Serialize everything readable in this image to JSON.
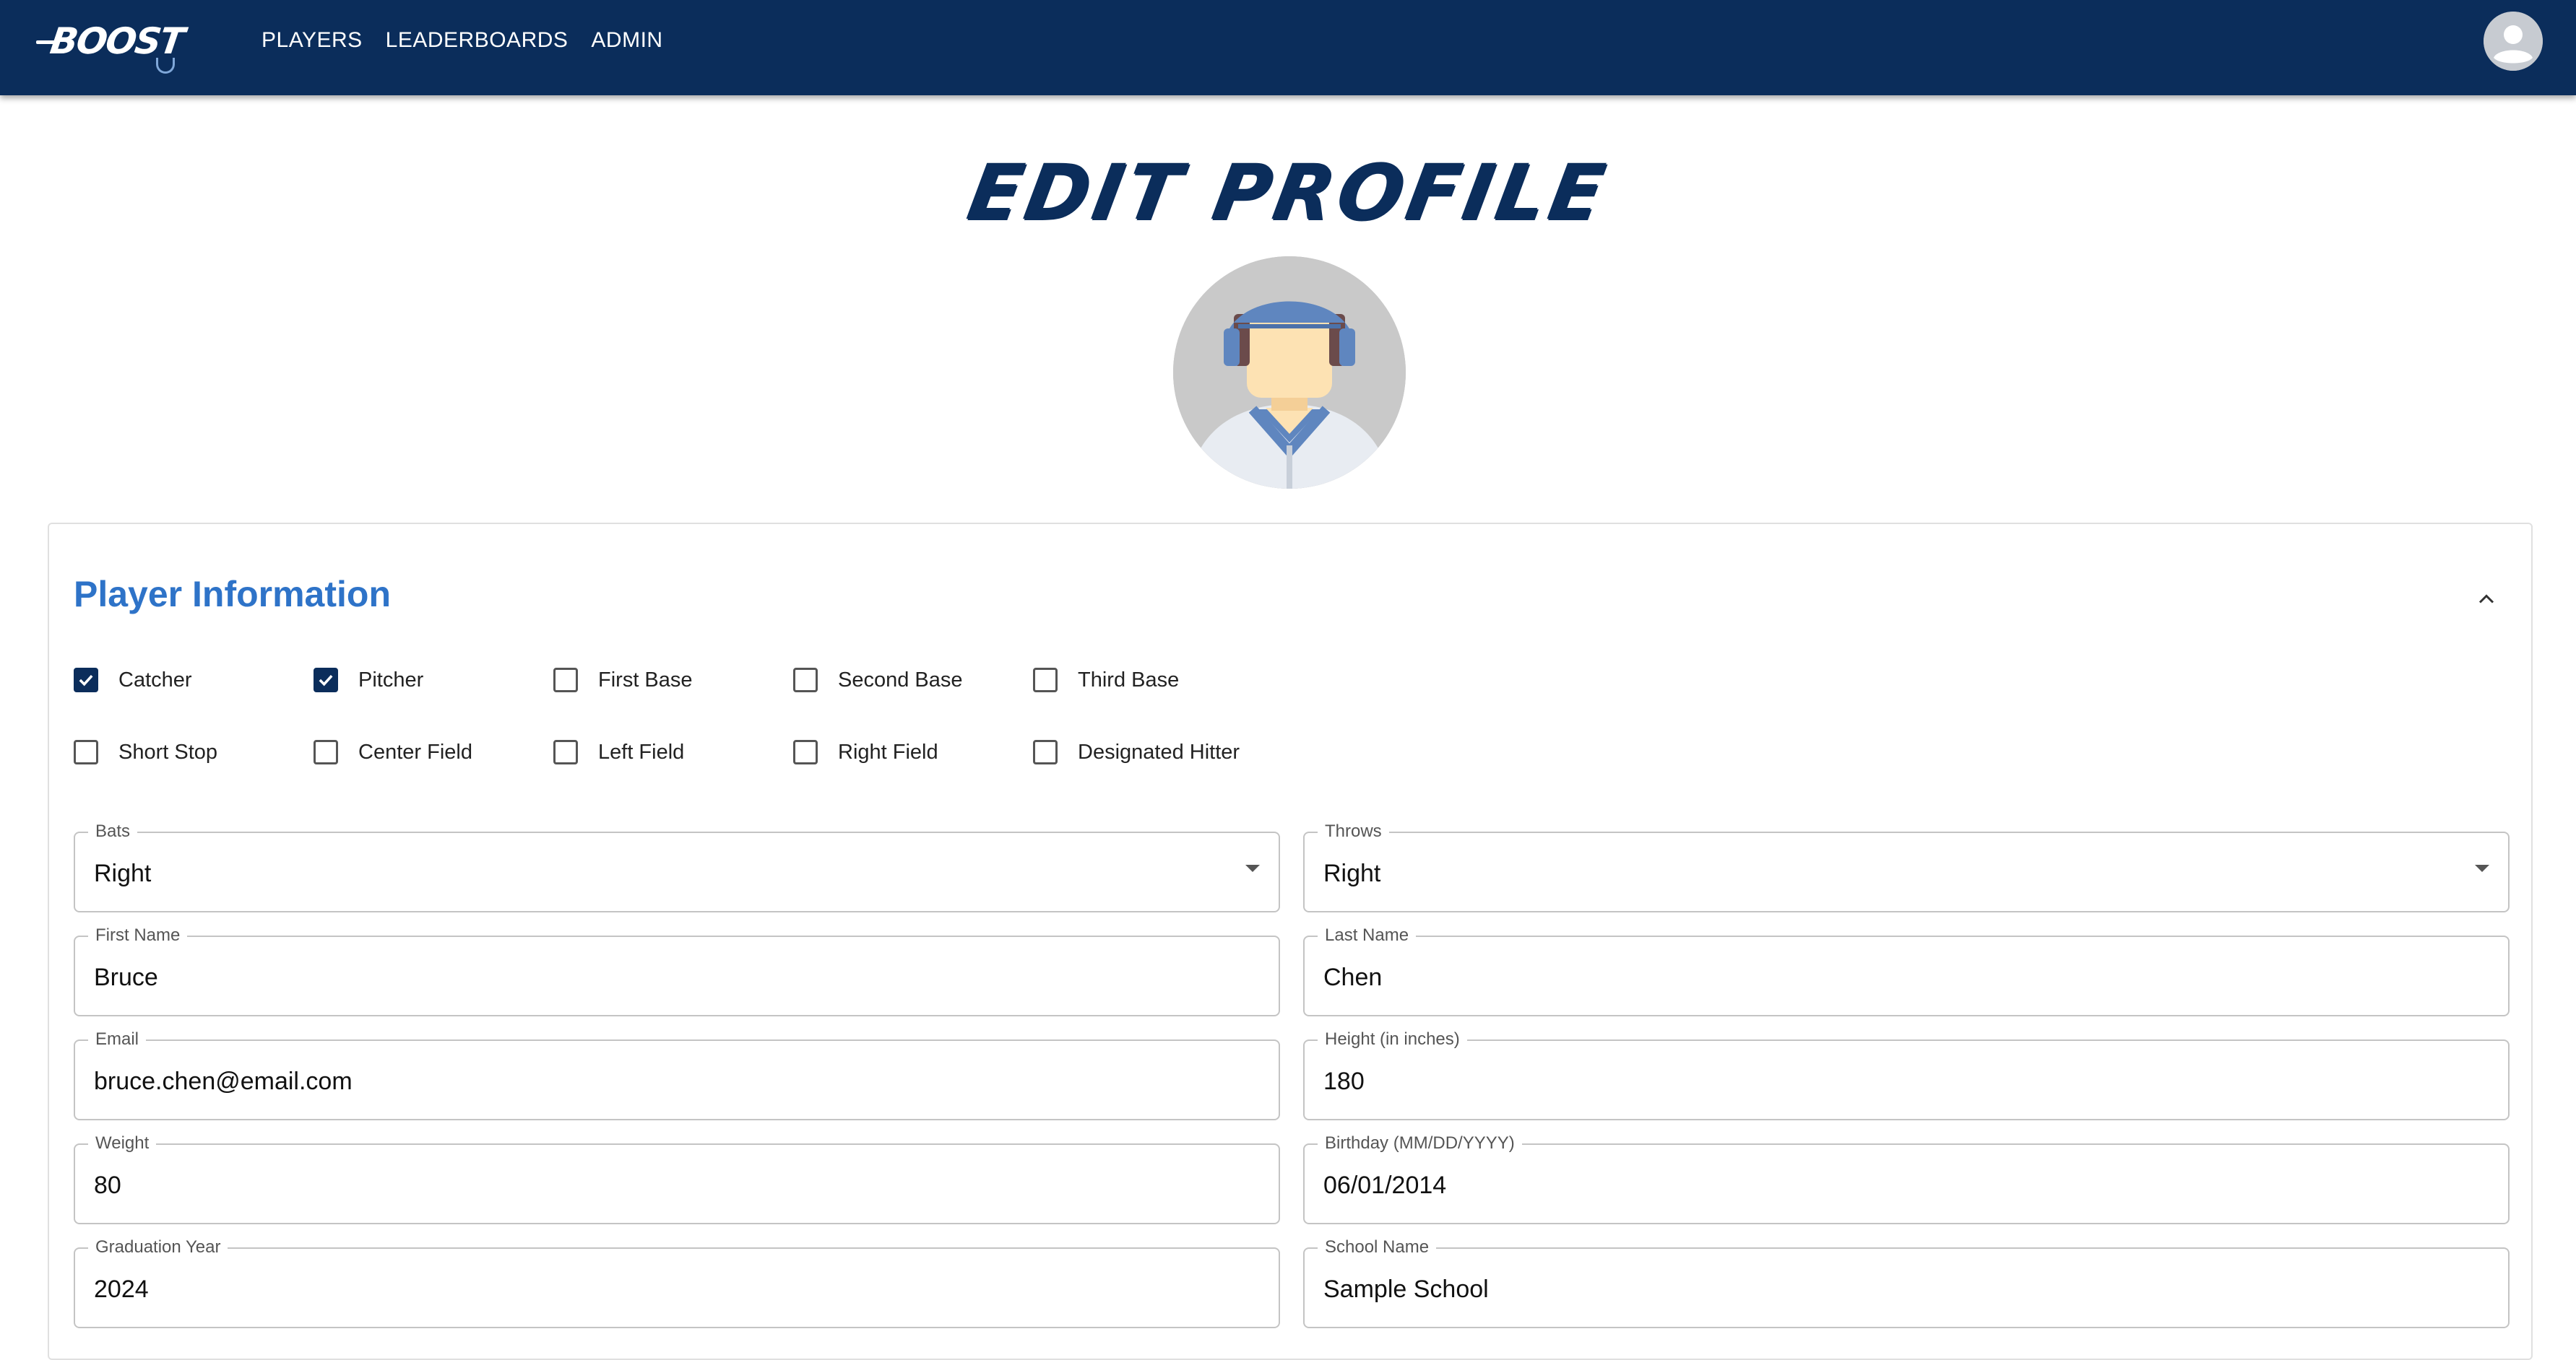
{
  "nav": {
    "logo_text": "BOOST",
    "links": [
      "PLAYERS",
      "LEADERBOARDS",
      "ADMIN"
    ]
  },
  "page": {
    "title": "EDIT PROFILE"
  },
  "card": {
    "title": "Player Information",
    "positions_row1": [
      {
        "label": "Catcher",
        "checked": true
      },
      {
        "label": "Pitcher",
        "checked": true
      },
      {
        "label": "First Base",
        "checked": false
      },
      {
        "label": "Second Base",
        "checked": false
      },
      {
        "label": "Third Base",
        "checked": false
      }
    ],
    "positions_row2": [
      {
        "label": "Short Stop",
        "checked": false
      },
      {
        "label": "Center Field",
        "checked": false
      },
      {
        "label": "Left Field",
        "checked": false
      },
      {
        "label": "Right Field",
        "checked": false
      },
      {
        "label": "Designated Hitter",
        "checked": false
      }
    ],
    "fields": {
      "bats": {
        "label": "Bats",
        "value": "Right"
      },
      "throws": {
        "label": "Throws",
        "value": "Right"
      },
      "first_name": {
        "label": "First Name",
        "value": "Bruce"
      },
      "last_name": {
        "label": "Last Name",
        "value": "Chen"
      },
      "email": {
        "label": "Email",
        "value": "bruce.chen@email.com"
      },
      "height": {
        "label": "Height (in inches)",
        "value": "180"
      },
      "weight": {
        "label": "Weight",
        "value": "80"
      },
      "birthday": {
        "label": "Birthday (MM/DD/YYYY)",
        "value": "06/01/2014"
      },
      "graduation_year": {
        "label": "Graduation Year",
        "value": "2024"
      },
      "school_name": {
        "label": "School Name",
        "value": "Sample School"
      }
    }
  },
  "colors": {
    "navbar": "#0b2d5b",
    "accent": "#2e73c8",
    "checkbox_checked": "#0b2d5b"
  },
  "icons": {
    "user_menu": "account-circle-icon",
    "collapse": "chevron-up-icon",
    "select": "caret-down-icon"
  }
}
